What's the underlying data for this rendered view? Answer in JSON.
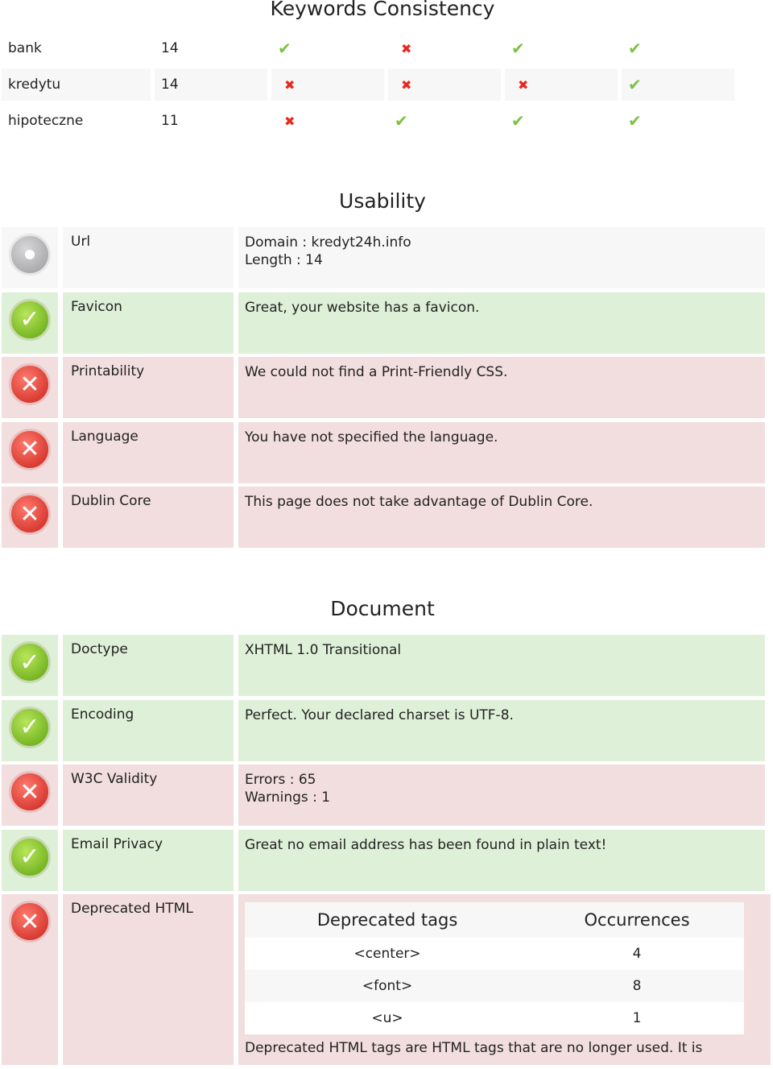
{
  "keywords": {
    "title": "Keywords Consistency",
    "rows": [
      {
        "word": "bank",
        "count": "14",
        "checks": [
          true,
          false,
          true,
          true
        ]
      },
      {
        "word": "kredytu",
        "count": "14",
        "checks": [
          false,
          false,
          false,
          true
        ]
      },
      {
        "word": "hipoteczne",
        "count": "11",
        "checks": [
          false,
          true,
          true,
          true
        ]
      }
    ]
  },
  "usability": {
    "title": "Usability",
    "rows": [
      {
        "status": "neutral",
        "label": "Url",
        "lines": [
          "Domain : kredyt24h.info",
          "Length : 14"
        ]
      },
      {
        "status": "pass",
        "label": "Favicon",
        "lines": [
          "Great, your website has a favicon."
        ]
      },
      {
        "status": "fail",
        "label": "Printability",
        "lines": [
          "We could not find a Print-Friendly CSS."
        ]
      },
      {
        "status": "fail",
        "label": "Language",
        "lines": [
          "You have not specified the language."
        ]
      },
      {
        "status": "fail",
        "label": "Dublin Core",
        "lines": [
          "This page does not take advantage of Dublin Core."
        ]
      }
    ]
  },
  "document": {
    "title": "Document",
    "rows": [
      {
        "status": "pass",
        "label": "Doctype",
        "lines": [
          "XHTML 1.0 Transitional"
        ]
      },
      {
        "status": "pass",
        "label": "Encoding",
        "lines": [
          "Perfect. Your declared charset is UTF-8."
        ]
      },
      {
        "status": "fail",
        "label": "W3C Validity",
        "lines": [
          "Errors : 65",
          "Warnings : 1"
        ]
      },
      {
        "status": "pass",
        "label": "Email Privacy",
        "lines": [
          "Great no email address has been found in plain text!"
        ]
      }
    ],
    "deprecated": {
      "status": "fail",
      "label": "Deprecated HTML",
      "headers": [
        "Deprecated tags",
        "Occurrences"
      ],
      "rows": [
        [
          "<center>",
          "4"
        ],
        [
          "<font>",
          "8"
        ],
        [
          "<u>",
          "1"
        ]
      ],
      "note": "Deprecated HTML tags are HTML tags that are no longer used. It is"
    }
  },
  "colors": {
    "pass": "#dff0d8",
    "fail": "#f2dede",
    "neutral": "#f7f7f7",
    "check": "#7cc142",
    "cross": "#e8281f"
  }
}
